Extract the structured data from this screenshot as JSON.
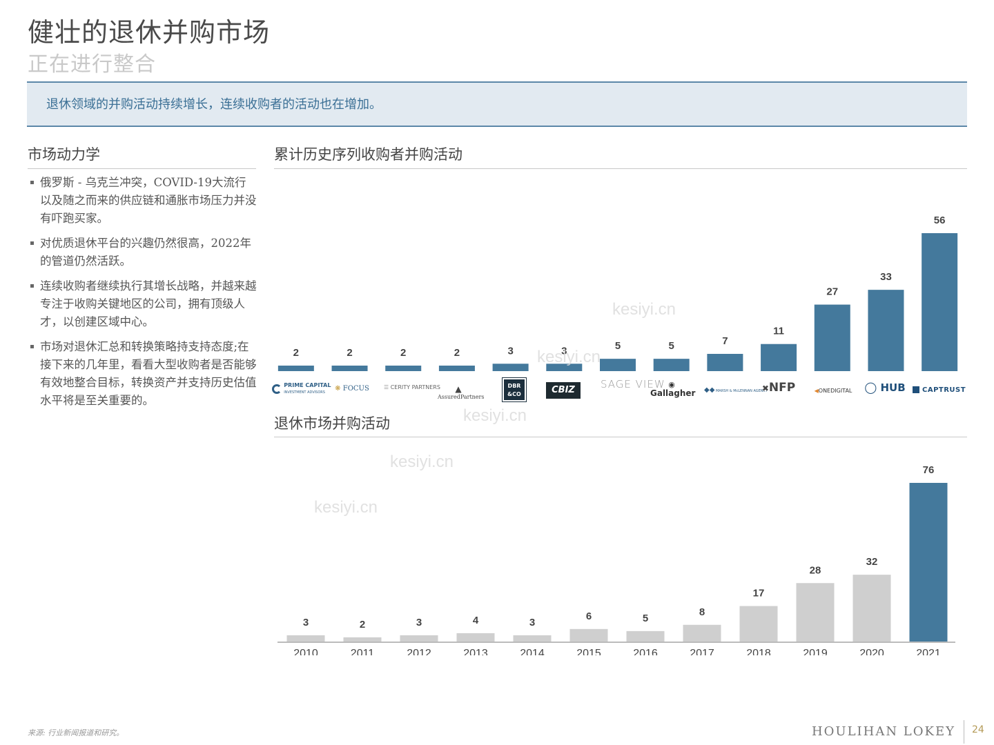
{
  "header": {
    "title": "健壮的退休并购市场",
    "subtitle": "正在进行整合",
    "banner": "退休领域的并购活动持续增长，连续收购者的活动也在增加。"
  },
  "left_section": {
    "heading": "市场动力学",
    "bullets": [
      "俄罗斯 - 乌克兰冲突，COVID-19大流行以及随之而来的供应链和通胀市场压力并没有吓跑买家。",
      "对优质退休平台的兴趣仍然很高，2022年的管道仍然活跃。",
      "连续收购者继续执行其增长战略，并越来越专注于收购关键地区的公司，拥有顶级人才，以创建区域中心。",
      "市场对退休汇总和转换策略持支持态度;在接下来的几年里，看看大型收购者是否能够有效地整合目标，转换资产并支持历史估值水平将是至关重要的。"
    ]
  },
  "watermark": "kesiyi.cn",
  "chart_data": [
    {
      "type": "bar",
      "title": "累计历史序列收购者并购活动",
      "categories": [
        "PRIME CAPITAL",
        "FOCUS",
        "CERITY PARTNERS",
        "AssuredPartners",
        "DBR & CO",
        "CBIZ",
        "SAGE VIEW",
        "Gallagher",
        "MARSH & McLENNAN AGENCY",
        "NFP",
        "ONEDIGITAL",
        "HUB",
        "CAPTRUST"
      ],
      "values": [
        2,
        2,
        2,
        2,
        3,
        3,
        5,
        5,
        7,
        11,
        27,
        33,
        56
      ],
      "colors": {
        "bar": "#44799c"
      }
    },
    {
      "type": "bar",
      "title": "退休市场并购活动",
      "categories": [
        "2010",
        "2011",
        "2012",
        "2013",
        "2014",
        "2015",
        "2016",
        "2017",
        "2018",
        "2019",
        "2020",
        "2021"
      ],
      "values": [
        3,
        2,
        3,
        4,
        3,
        6,
        5,
        8,
        17,
        28,
        32,
        76
      ],
      "colors": {
        "default": "#cfcfcf",
        "highlight": "#44799c"
      },
      "highlight_category": "2021"
    }
  ],
  "logo_texts": {
    "prime": "PRIME CAPITAL",
    "prime_sub": "INVESTMENT ADVISORS",
    "focus": "FOCUS",
    "cerity": "CERITY PARTNERS",
    "assured": "AssuredPartners",
    "dbr": "DBR &CO",
    "cbiz": "CBIZ",
    "sage": "SAGE VIEW",
    "gallagher": "Gallagher",
    "marsh": "MARSH & McLENNAN AGENCY",
    "nfp": "NFP",
    "onedigital": "ONEDIGITAL",
    "hub": "HUB",
    "captrust": "CAPTRUST"
  },
  "footer": {
    "source": "来源: 行业新闻报道和研究。",
    "brand": "HOULIHAN LOKEY",
    "page": "24"
  }
}
